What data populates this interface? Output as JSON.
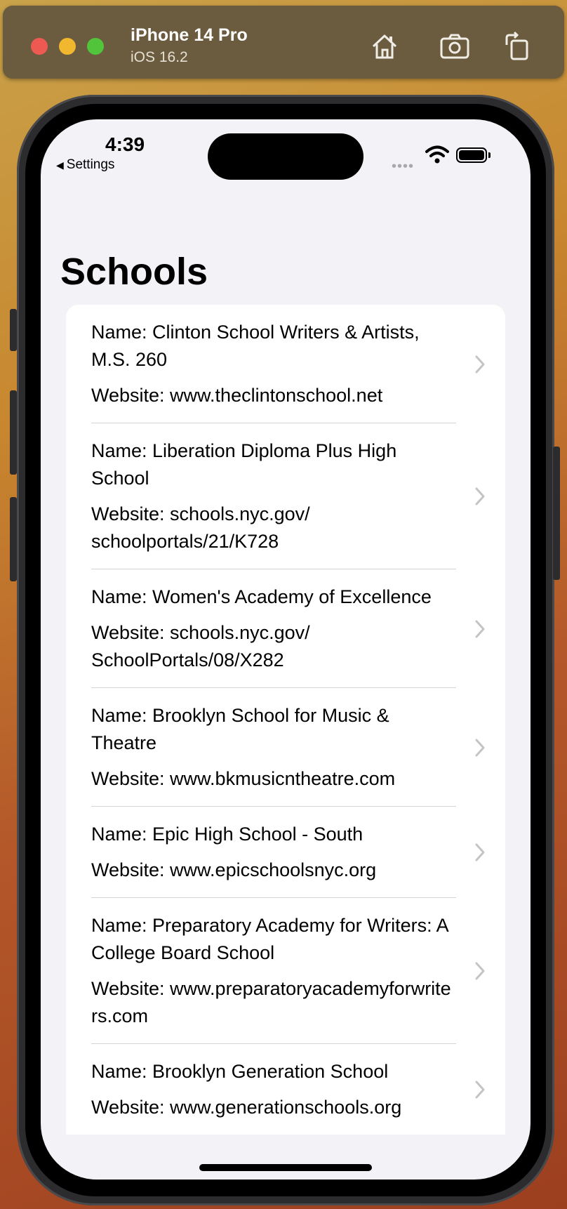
{
  "simulator": {
    "device_name": "iPhone 14 Pro",
    "os_version": "iOS 16.2"
  },
  "status_bar": {
    "time": "4:39",
    "back_label": "Settings",
    "signal_dots": "••••"
  },
  "page": {
    "title": "Schools"
  },
  "schools": [
    {
      "name": "Name: Clinton School Writers & Artists, M.S. 260",
      "website": "Website: www.theclintonschool.net"
    },
    {
      "name": "Name: Liberation Diploma Plus High School",
      "website": "Website: schools.nyc.gov/ schoolportals/21/K728"
    },
    {
      "name": "Name: Women's Academy of Excellence",
      "website": "Website: schools.nyc.gov/ SchoolPortals/08/X282"
    },
    {
      "name": "Name: Brooklyn School for Music & Theatre",
      "website": "Website: www.bkmusicntheatre.com"
    },
    {
      "name": "Name: Epic High School - South",
      "website": "Website: www.epicschoolsnyc.org"
    },
    {
      "name": "Name: Preparatory Academy for Writers: A College Board School",
      "website": "Website: www.preparatoryacademyforwriters.com"
    },
    {
      "name": "Name: Brooklyn Generation School",
      "website": "Website: www.generationschools.org"
    }
  ],
  "icons": {
    "home": "home-icon",
    "screenshot": "camera-icon",
    "rotate": "rotate-icon",
    "chevron": "chevron-right-icon"
  },
  "colors": {
    "background": "#f2f2f7",
    "card": "#ffffff",
    "separator": "#d4d4d8",
    "chevron": "#c4c4c7"
  }
}
